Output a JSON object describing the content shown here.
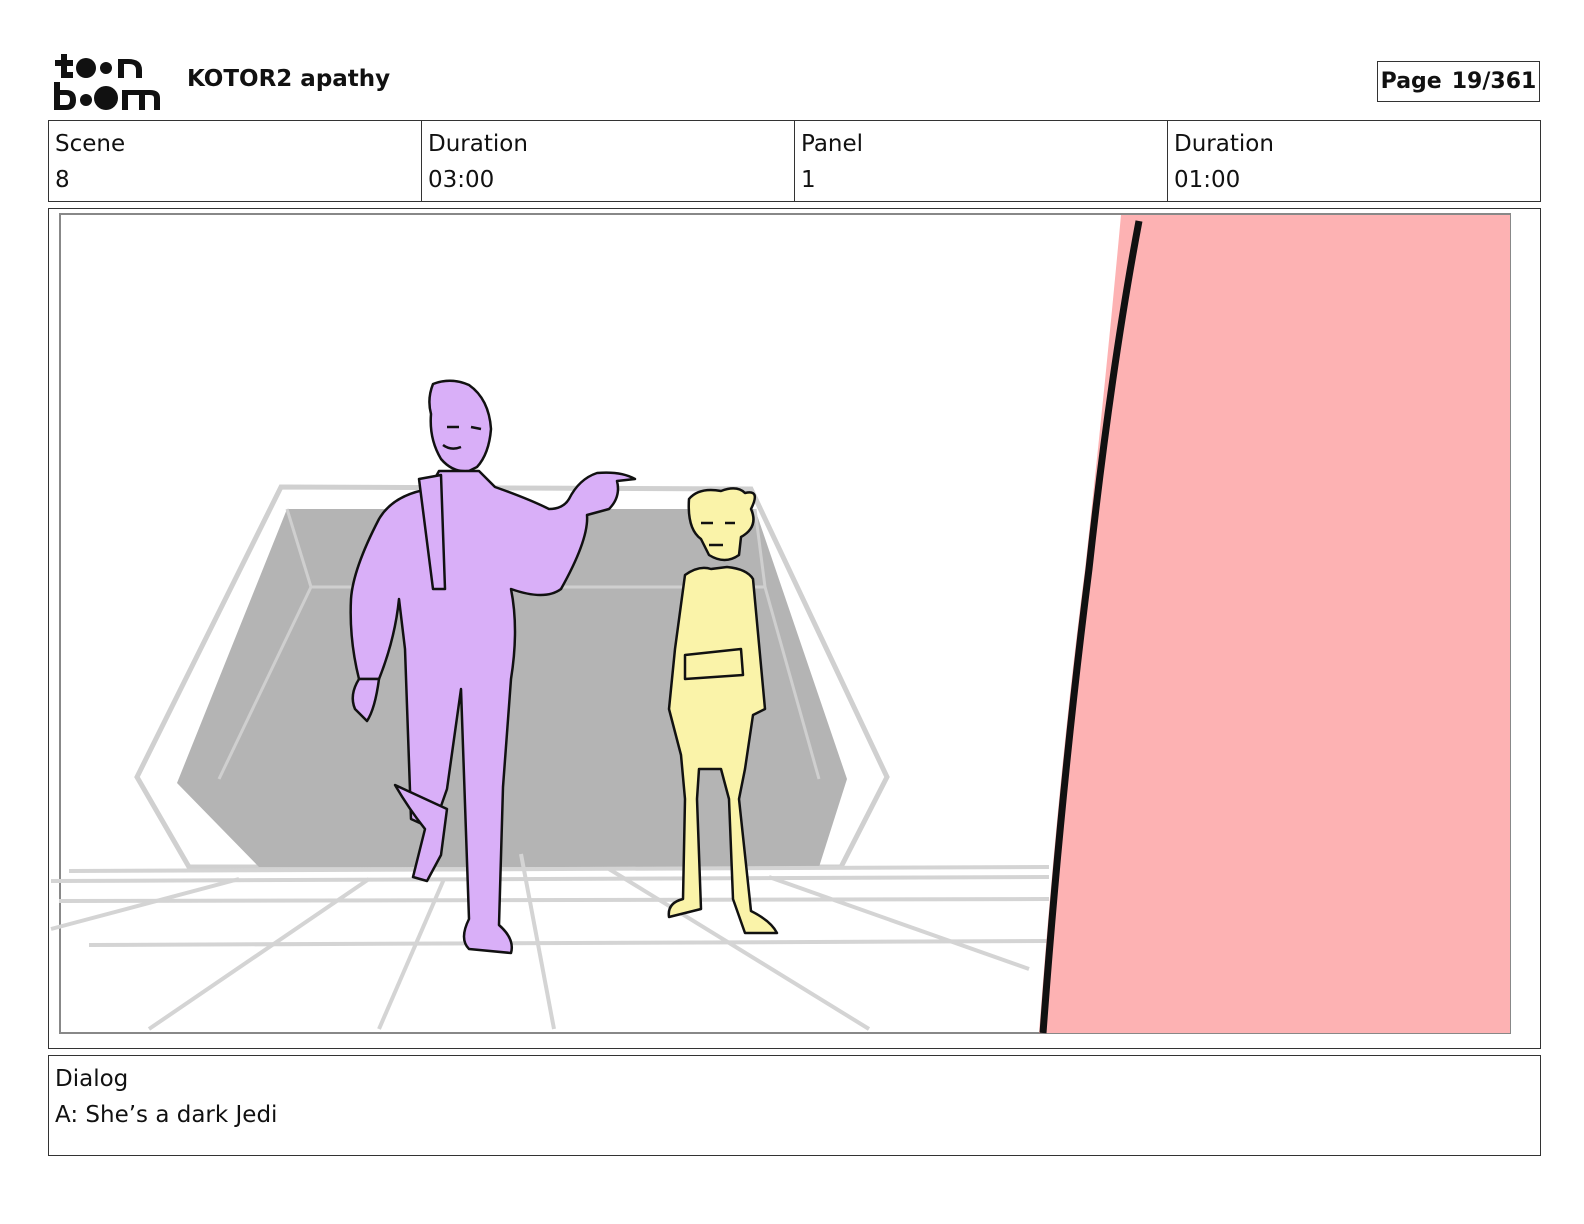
{
  "header": {
    "logo_line1": "t••n",
    "logo_line2": "b••m",
    "project_title": "KOTOR2 apathy",
    "page_label": "Page",
    "page_number": "19/361"
  },
  "info": {
    "scene_label": "Scene",
    "scene_value": "8",
    "scene_duration_label": "Duration",
    "scene_duration_value": "03:00",
    "panel_label": "Panel",
    "panel_value": "1",
    "panel_duration_label": "Duration",
    "panel_duration_value": "01:00"
  },
  "dialog": {
    "label": "Dialog",
    "text": "A: She’s a dark Jedi"
  },
  "colors": {
    "purple_character": "#d9aff8",
    "yellow_character": "#faf3a9",
    "foreground_red": "#fdb2b3",
    "doorway_gray": "#b4b4b4"
  }
}
